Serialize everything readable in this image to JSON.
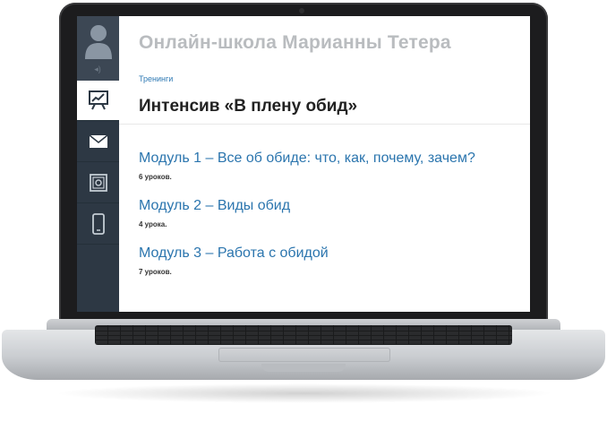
{
  "header": {
    "school_title": "Онлайн-школа Марианны Тетера"
  },
  "breadcrumb": {
    "label": "Тренинги"
  },
  "course": {
    "title": "Интенсив «В плену обид»"
  },
  "modules": [
    {
      "title": "Модуль 1 – Все об обиде: что, как, почему, зачем?",
      "count": "6 уроков."
    },
    {
      "title": "Модуль 2 – Виды обид",
      "count": "4 урока."
    },
    {
      "title": "Модуль 3 – Работа с обидой",
      "count": "7 уроков."
    }
  ],
  "sidebar": {
    "items": [
      {
        "icon": "chart-presentation-icon",
        "active": true
      },
      {
        "icon": "mail-icon",
        "active": false
      },
      {
        "icon": "safe-icon",
        "active": false
      },
      {
        "icon": "mobile-phone-icon",
        "active": false
      }
    ]
  },
  "colors": {
    "sidebar": "#2d3844",
    "link": "#2b75ae",
    "title_gray": "#b9bcbf"
  }
}
